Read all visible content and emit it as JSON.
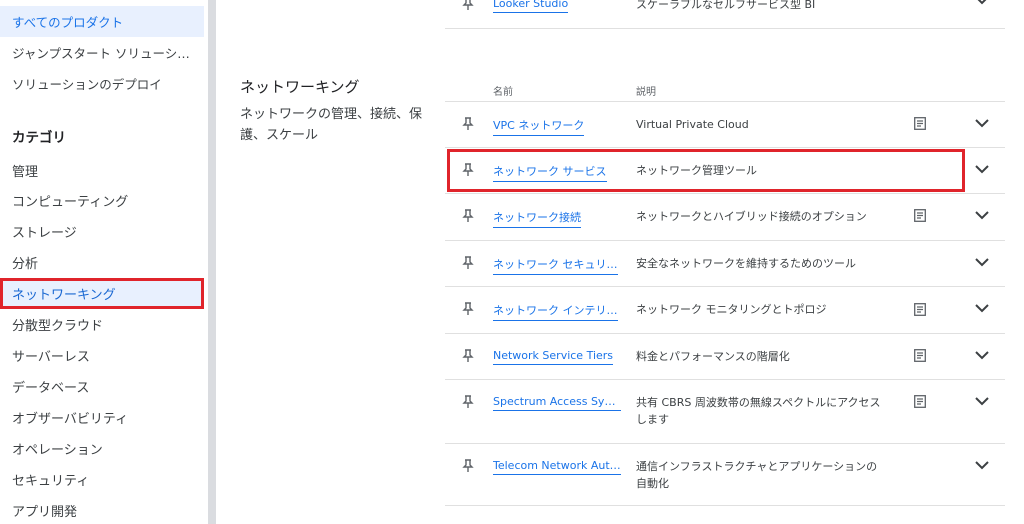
{
  "sidebar": {
    "top_items": [
      {
        "label": "すべてのプロダクト",
        "selected": true
      },
      {
        "label": "ジャンプスタート ソリューシ…"
      },
      {
        "label": "ソリューションのデプロイ"
      }
    ],
    "category_header": "カテゴリ",
    "categories": [
      {
        "label": "管理"
      },
      {
        "label": "コンピューティング"
      },
      {
        "label": "ストレージ"
      },
      {
        "label": "分析"
      },
      {
        "label": "ネットワーキング",
        "selected": true
      },
      {
        "label": "分散型クラウド"
      },
      {
        "label": "サーバーレス"
      },
      {
        "label": "データベース"
      },
      {
        "label": "オブザーバビリティ"
      },
      {
        "label": "オペレーション"
      },
      {
        "label": "セキュリティ"
      },
      {
        "label": "アプリ開発"
      }
    ]
  },
  "prev_row": {
    "name": "Looker Studio",
    "desc": "スケーラブルなセルフサービス型 BI"
  },
  "section": {
    "title": "ネットワーキング",
    "description": "ネットワークの管理、接続、保護、スケール"
  },
  "table": {
    "headers": {
      "name": "名前",
      "description": "説明"
    },
    "rows": [
      {
        "name": "VPC ネットワーク",
        "desc": "Virtual Private Cloud",
        "doc": true
      },
      {
        "name": "ネットワーク サービス",
        "desc": "ネットワーク管理ツール",
        "doc": false
      },
      {
        "name": "ネットワーク接続",
        "desc": "ネットワークとハイブリッド接続のオプション",
        "doc": true
      },
      {
        "name": "ネットワーク セキュリ…",
        "desc": "安全なネットワークを維持するためのツール",
        "doc": false
      },
      {
        "name": "ネットワーク インテリ…",
        "desc": "ネットワーク モニタリングとトポロジ",
        "doc": true
      },
      {
        "name": "Network Service Tiers",
        "desc": "料金とパフォーマンスの階層化",
        "doc": true
      },
      {
        "name": "Spectrum Access System",
        "desc": "共有 CBRS 周波数帯の無線スペクトルにアクセスします",
        "doc": true
      },
      {
        "name": "Telecom Network Auto…",
        "desc": "通信インフラストラクチャとアプリケーションの自動化",
        "doc": false
      }
    ]
  },
  "colors": {
    "accent": "#1a73e8",
    "highlight": "#e0242b",
    "selected_bg": "#e8f0fe"
  }
}
